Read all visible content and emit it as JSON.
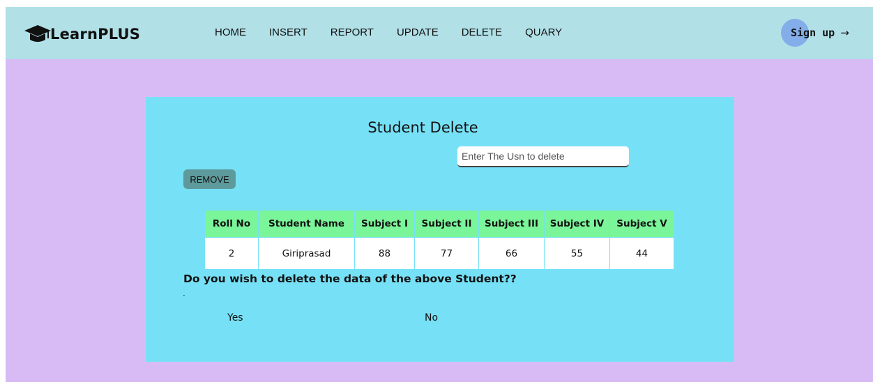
{
  "brand": {
    "name": "LearnPLUS",
    "logo_icon": "graduation-cap-icon"
  },
  "nav": [
    "HOME",
    "INSERT",
    "REPORT",
    "UPDATE",
    "DELETE",
    "QUARY"
  ],
  "signup": {
    "label": "Sign up",
    "arrow": "→"
  },
  "panel": {
    "title": "Student Delete",
    "usn_placeholder": "Enter The Usn to delete",
    "usn_value": "",
    "remove_label": "REMOVE"
  },
  "table": {
    "headers": [
      "Roll No",
      "Student Name",
      "Subject I",
      "Subject II",
      "Subject III",
      "Subject IV",
      "Subject V"
    ],
    "rows": [
      [
        "2",
        "Giriprasad",
        "88",
        "77",
        "66",
        "55",
        "44"
      ]
    ]
  },
  "confirm": {
    "question": "Do you wish to delete the data of the above Student??",
    "dot": ".",
    "yes": "Yes",
    "no": "No"
  },
  "colors": {
    "page_bg": "#d8bbf5",
    "navbar_bg": "#b1e0e7",
    "panel_bg": "#76e1f6",
    "table_header_bg": "#7af599",
    "remove_button_bg": "#5e9a9b",
    "signup_circle": "#84aeea"
  }
}
